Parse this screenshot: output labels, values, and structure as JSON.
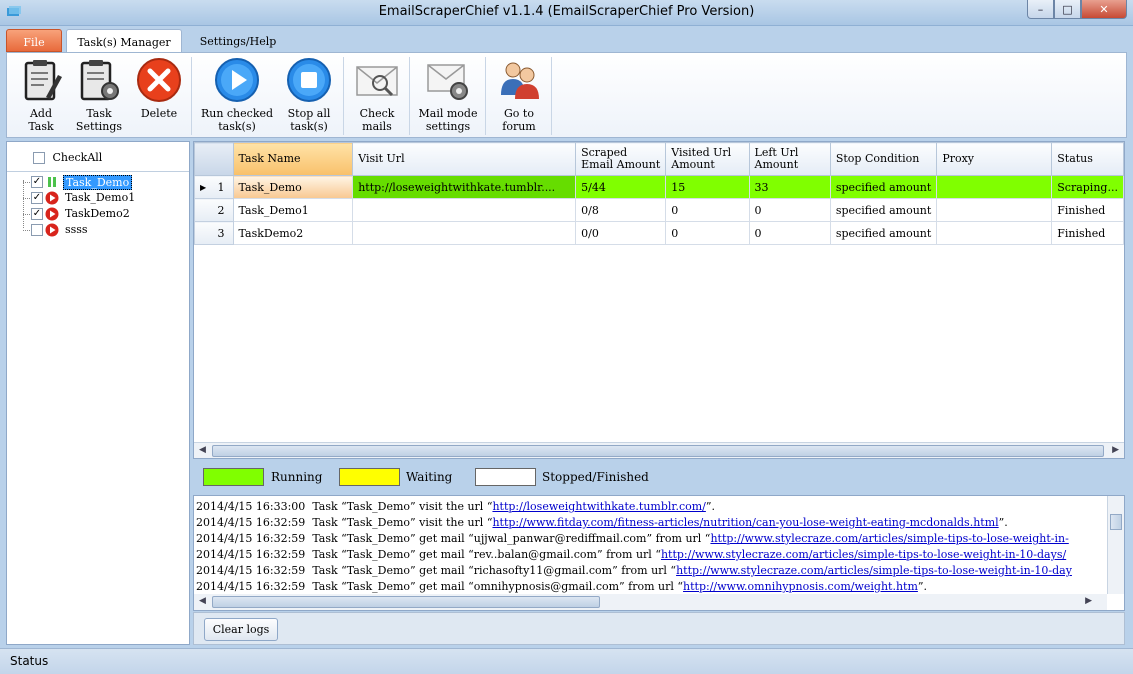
{
  "window": {
    "title": "EmailScraperChief v1.1.4 (EmailScraperChief Pro Version)"
  },
  "menu": {
    "tabs": [
      {
        "label": "File"
      },
      {
        "label": "Task(s) Manager"
      },
      {
        "label": "Settings/Help"
      }
    ]
  },
  "ribbon": {
    "add_task": "Add\nTask",
    "task_settings": "Task\nSettings",
    "delete": "Delete",
    "run_checked": "Run checked\ntask(s)",
    "stop_all": "Stop all\ntask(s)",
    "check_mails": "Check\nmails",
    "mail_mode": "Mail mode\nsettings",
    "forum": "Go to\nforum"
  },
  "tree": {
    "check_all": "CheckAll",
    "tasks": [
      {
        "name": "Task_Demo",
        "checked": true,
        "state": "running"
      },
      {
        "name": "Task_Demo1",
        "checked": true,
        "state": "stopped"
      },
      {
        "name": "TaskDemo2",
        "checked": true,
        "state": "stopped"
      },
      {
        "name": "ssss",
        "checked": false,
        "state": "stopped"
      }
    ]
  },
  "grid": {
    "columns": [
      "Task Name",
      "Visit Url",
      "Scraped\nEmail Amount",
      "Visited Url\nAmount",
      "Left Url\nAmount",
      "Stop Condition",
      "Proxy",
      "Status"
    ],
    "rows": [
      {
        "num": "1",
        "task_name": "Task_Demo",
        "visit_url": "http://loseweightwithkate.tumblr....",
        "scraped": "5/44",
        "visited": "15",
        "left": "33",
        "stop_condition": "specified amount",
        "proxy": "",
        "status": "Scraping..."
      },
      {
        "num": "2",
        "task_name": "Task_Demo1",
        "visit_url": "",
        "scraped": "0/8",
        "visited": "0",
        "left": "0",
        "stop_condition": "specified amount",
        "proxy": "",
        "status": "Finished"
      },
      {
        "num": "3",
        "task_name": "TaskDemo2",
        "visit_url": "",
        "scraped": "0/0",
        "visited": "0",
        "left": "0",
        "stop_condition": "specified amount",
        "proxy": "",
        "status": "Finished"
      }
    ]
  },
  "legend": {
    "running": "Running",
    "waiting": "Waiting",
    "stopped": "Stopped/Finished",
    "colors": {
      "running": "#80ff00",
      "waiting": "#ffff00",
      "stopped": "#ffffff"
    }
  },
  "logs": [
    {
      "time": "2014/4/15 16:33:00",
      "pre": "Task “Task_Demo” visit the url “",
      "link": "http://loseweightwithkate.tumblr.com/",
      "post": "”."
    },
    {
      "time": "2014/4/15 16:32:59",
      "pre": "Task “Task_Demo” visit the url “",
      "link": "http://www.fitday.com/fitness-articles/nutrition/can-you-lose-weight-eating-mcdonalds.html",
      "post": "”."
    },
    {
      "time": "2014/4/15 16:32:59",
      "pre": "Task “Task_Demo” get mail “ujjwal_panwar@rediffmail.com” from url “",
      "link": "http://www.stylecraze.com/articles/simple-tips-to-lose-weight-in-",
      "post": ""
    },
    {
      "time": "2014/4/15 16:32:59",
      "pre": "Task “Task_Demo” get mail “rev..balan@gmail.com” from url “",
      "link": "http://www.stylecraze.com/articles/simple-tips-to-lose-weight-in-10-days/",
      "post": ""
    },
    {
      "time": "2014/4/15 16:32:59",
      "pre": "Task “Task_Demo” get mail “richasofty11@gmail.com” from url “",
      "link": "http://www.stylecraze.com/articles/simple-tips-to-lose-weight-in-10-day",
      "post": ""
    },
    {
      "time": "2014/4/15 16:32:59",
      "pre": "Task “Task_Demo” get mail “omnihypnosis@gmail.com” from url “",
      "link": "http://www.omnihypnosis.com/weight.htm",
      "post": "”."
    }
  ],
  "bottom": {
    "clear_logs": "Clear logs"
  },
  "statusbar": {
    "text": "Status"
  }
}
